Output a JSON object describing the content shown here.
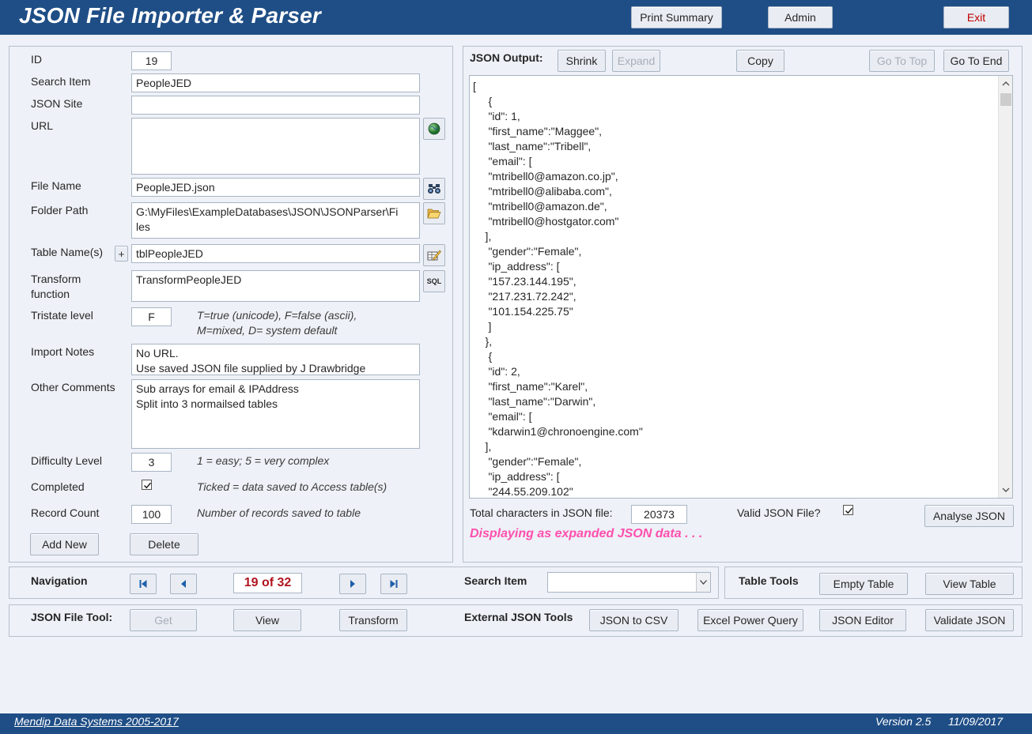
{
  "header": {
    "title": "JSON File Importer & Parser",
    "print_summary": "Print Summary",
    "admin": "Admin",
    "exit": "Exit"
  },
  "form": {
    "id_label": "ID",
    "id_value": "19",
    "search_item_label": "Search Item",
    "search_item_value": "PeopleJED",
    "json_site_label": "JSON Site",
    "json_site_value": "",
    "url_label": "URL",
    "url_value": "",
    "file_name_label": "File Name",
    "file_name_value": "PeopleJED.json",
    "folder_path_label": "Folder Path",
    "folder_path_value": "G:\\MyFiles\\ExampleDatabases\\JSON\\JSONParser\\Fi\nles",
    "table_names_label": "Table Name(s)",
    "table_plus": "+",
    "table_names_value": "tblPeopleJED",
    "transform_label": "Transform\nfunction",
    "transform_value": "TransformPeopleJED",
    "sql_icon_text": "SQL",
    "tristate_label": "Tristate level",
    "tristate_value": "F",
    "tristate_hint": "T=true (unicode), F=false (ascii),\nM=mixed, D= system default",
    "import_notes_label": "Import Notes",
    "import_notes_value": "No URL.\nUse saved JSON file supplied by J Drawbridge",
    "other_comments_label": "Other Comments",
    "other_comments_value": "Sub arrays for email & IPAddress\nSplit into 3 normailsed tables",
    "difficulty_label": "Difficulty Level",
    "difficulty_value": "3",
    "difficulty_hint": "1 = easy; 5 = very complex",
    "completed_label": "Completed",
    "completed_checked": true,
    "completed_hint": "Ticked = data saved to Access table(s)",
    "record_count_label": "Record Count",
    "record_count_value": "100",
    "record_count_hint": "Number of records saved to table",
    "add_new": "Add New",
    "delete": "Delete"
  },
  "json_panel": {
    "label": "JSON Output:",
    "shrink": "Shrink",
    "expand": "Expand",
    "copy": "Copy",
    "go_to_top": "Go To Top",
    "go_to_end": "Go To End",
    "content": "[\n     {\n     \"id\": 1,\n     \"first_name\":\"Maggee\",\n     \"last_name\":\"Tribell\",\n     \"email\": [\n     \"mtribell0@amazon.co.jp\",\n     \"mtribell0@alibaba.com\",\n     \"mtribell0@amazon.de\",\n     \"mtribell0@hostgator.com\"\n    ],\n     \"gender\":\"Female\",\n     \"ip_address\": [\n     \"157.23.144.195\",\n     \"217.231.72.242\",\n     \"101.154.225.75\"\n     ]\n    },\n     {\n     \"id\": 2,\n     \"first_name\":\"Karel\",\n     \"last_name\":\"Darwin\",\n     \"email\": [\n     \"kdarwin1@chronoengine.com\"\n    ],\n     \"gender\":\"Female\",\n     \"ip_address\": [\n     \"244.55.209.102\"",
    "total_chars_label": "Total characters in JSON file:",
    "total_chars_value": "20373",
    "valid_label": "Valid JSON File?",
    "valid_checked": true,
    "analyse": "Analyse JSON",
    "status": "Displaying as expanded JSON data . . ."
  },
  "navigation": {
    "label": "Navigation",
    "record_position": "19 of 32",
    "search_label": "Search Item",
    "search_value": ""
  },
  "table_tools": {
    "label": "Table Tools",
    "empty_table": "Empty Table",
    "view_table": "View Table"
  },
  "file_tools": {
    "label": "JSON File Tool:",
    "get": "Get",
    "view": "View",
    "transform": "Transform"
  },
  "external_tools": {
    "label": "External JSON Tools",
    "json_to_csv": "JSON to CSV",
    "excel_power_query": "Excel Power Query",
    "json_editor": "JSON Editor",
    "validate_json": "Validate JSON"
  },
  "footer": {
    "company": "Mendip Data Systems 2005-2017",
    "version": "Version 2.5",
    "date": "11/09/2017"
  },
  "colors": {
    "header_bg": "#1f4e86",
    "status_pink": "#ff4fae",
    "record_red": "#b0141e",
    "exit_red": "#c00000"
  }
}
